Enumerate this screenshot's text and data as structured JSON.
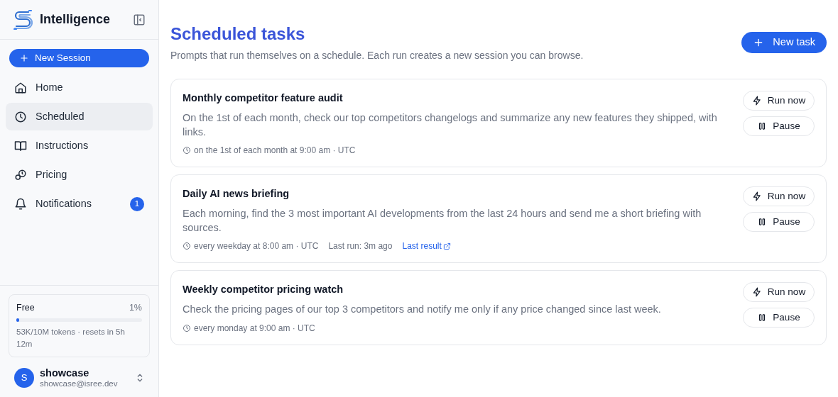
{
  "brand": {
    "name": "Intelligence"
  },
  "sidebar": {
    "new_session": "New Session",
    "items": [
      {
        "label": "Home",
        "selected": false
      },
      {
        "label": "Scheduled",
        "selected": true
      },
      {
        "label": "Instructions",
        "selected": false
      },
      {
        "label": "Pricing",
        "selected": false
      },
      {
        "label": "Notifications",
        "selected": false,
        "badge": "1"
      }
    ],
    "usage": {
      "plan": "Free",
      "percent": "1%",
      "level": 0.01,
      "detail": "53K/10M tokens · resets in 5h 12m"
    },
    "user": {
      "initial": "S",
      "name": "showcase",
      "email": "showcase@isree.dev"
    }
  },
  "main": {
    "title": "Scheduled tasks",
    "subtitle": "Prompts that run themselves on a schedule. Each run creates a new session you can browse.",
    "new_task": "New task",
    "tasks": [
      {
        "title": "Monthly competitor feature audit",
        "description": "On the 1st of each month, check our top competitors changelogs and summarize any new features they shipped, with links.",
        "schedule": "on the 1st of each month at 9:00 am · UTC",
        "run": "Run now",
        "pause": "Pause"
      },
      {
        "title": "Daily AI news briefing",
        "description": "Each morning, find the 3 most important AI developments from the last 24 hours and send me a short briefing with sources.",
        "schedule": "every weekday at 8:00 am · UTC",
        "last_run": "Last run: 3m ago",
        "last_result": "Last result",
        "run": "Run now",
        "pause": "Pause"
      },
      {
        "title": "Weekly competitor pricing watch",
        "description": "Check the pricing pages of our top 3 competitors and notify me only if any price changed since last week.",
        "schedule": "every monday at 9:00 am · UTC",
        "run": "Run now",
        "pause": "Pause"
      }
    ]
  }
}
